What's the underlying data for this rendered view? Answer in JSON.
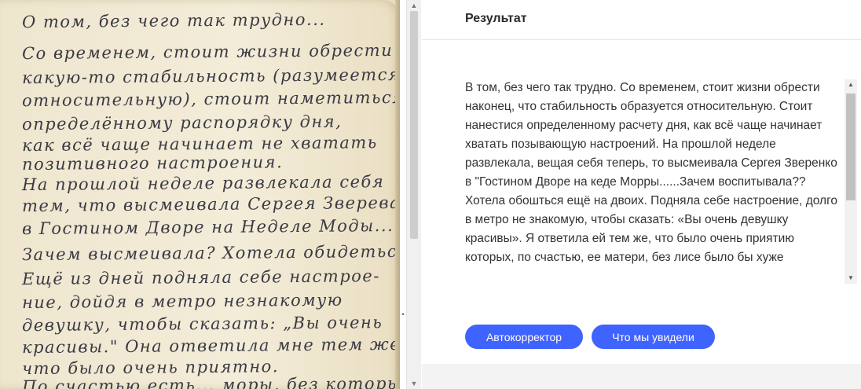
{
  "image_panel": {
    "handwritten_lines": [
      "О том, без чего так трудно...",
      "Со временем, стоит жизни обрести",
      "какую-то стабильность (разумеется,",
      "относительную), стоит наметиться",
      "определённому распорядку дня,",
      "как всё чаще начинает не хватать",
      "позитивного настроения.",
      "На прошлой неделе развлекала себя",
      "тем, что высмеивала Сергея Зверева",
      "в Гостином Дворе на Неделе Моды...",
      "Зачем высмеивала? Хотела обидеться =)",
      "Ещё из дней подняла себе настрое-",
      "ние, дойдя в метро незнакомую",
      "девушку, чтобы сказать: „Вы очень",
      "красивы.\" Она ответила мне тем же,",
      "что было очень приятно.",
      "По счастью есть... моры, без которых"
    ]
  },
  "result": {
    "title": "Результат",
    "text": "В том, без чего так трудно. Со временем, стоит жизни обрести наконец, что стабильность образуется относительную. Стоит нанестися определенному расчету дня, как всё чаще начинает хватать позывающую настроений. На прошлой неделе развлекала, вещая себя теперь, то высмеивала Сергея Зверенко в \"Гостином Дворе на кеде Морры......Зачем воспитывала?? Хотела обошться ещё на двоих. Подняла себе настроение, долго в метро не знакомую, чтобы сказать: «Вы очень девушку красивы». Я ответила ей тем же, что было очень приятию которых, по счастью, ее матери, без лисе было бы хуже",
    "buttons": {
      "autocorrect": "Автокорректор",
      "what_we_saw": "Что мы увидели"
    },
    "accent_color": "#3f63ff"
  },
  "icons": {
    "scroll_up": "▲",
    "scroll_down": "▼"
  }
}
